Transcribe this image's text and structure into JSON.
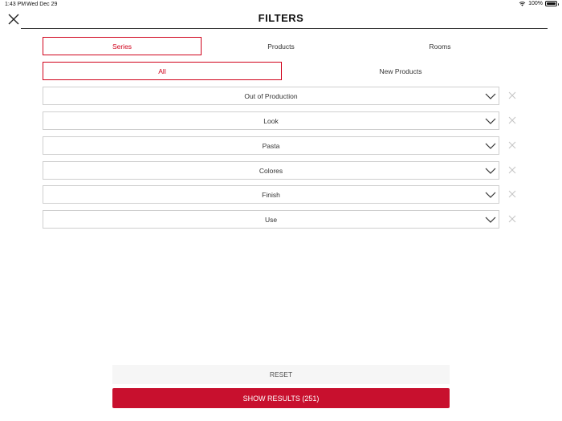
{
  "status_bar": {
    "time": "1:43 PM",
    "date": "Wed Dec 29",
    "battery": "100%"
  },
  "header": {
    "title": "FILTERS",
    "close_icon": "close-icon"
  },
  "tabs_primary": [
    {
      "label": "Series",
      "active": true
    },
    {
      "label": "Products",
      "active": false
    },
    {
      "label": "Rooms",
      "active": false
    }
  ],
  "tabs_secondary": [
    {
      "label": "All",
      "active": true
    },
    {
      "label": "New Products",
      "active": false
    }
  ],
  "filters": [
    {
      "label": "Out of Production"
    },
    {
      "label": "Look"
    },
    {
      "label": "Pasta"
    },
    {
      "label": "Colores"
    },
    {
      "label": "Finish"
    },
    {
      "label": "Use"
    }
  ],
  "footer": {
    "reset_label": "RESET",
    "show_results_label": "SHOW RESULTS (251)"
  },
  "colors": {
    "accent": "#d0021b",
    "primary_button": "#c8102e",
    "border": "#cfcfcf"
  }
}
